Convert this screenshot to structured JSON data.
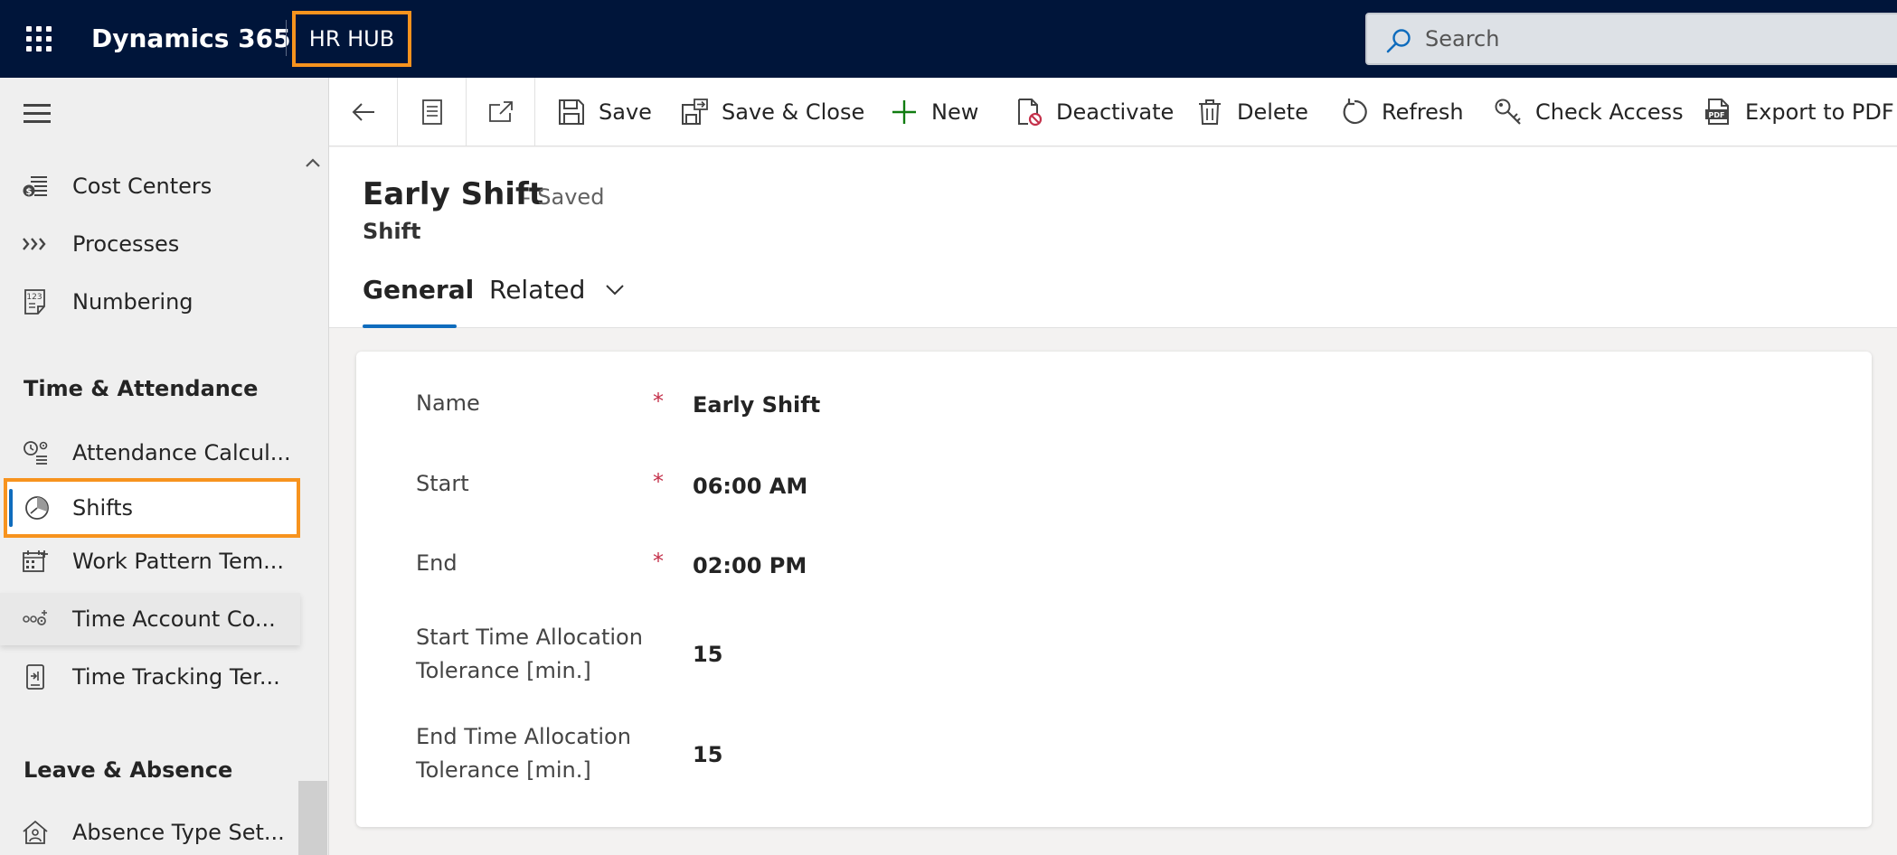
{
  "app": {
    "brand": "Dynamics 365",
    "title": "HR HUB"
  },
  "search": {
    "placeholder": "Search"
  },
  "sidebar": {
    "items": [
      {
        "label": "Cost Centers",
        "icon": "cost-center-icon"
      },
      {
        "label": "Processes",
        "icon": "processes-icon"
      },
      {
        "label": "Numbering",
        "icon": "numbering-icon"
      }
    ],
    "groups": [
      {
        "title": "Time & Attendance",
        "items": [
          {
            "label": "Attendance Calcul...",
            "icon": "attendance-calc-icon"
          },
          {
            "label": "Shifts",
            "icon": "shift-clock-icon",
            "selected": true
          },
          {
            "label": "Work Pattern Tem...",
            "icon": "calendar-icon"
          },
          {
            "label": "Time Account Co...",
            "icon": "time-account-icon"
          },
          {
            "label": "Time Tracking Ter...",
            "icon": "terminal-icon"
          }
        ]
      },
      {
        "title": "Leave & Absence",
        "items": [
          {
            "label": "Absence Type Set...",
            "icon": "absence-house-icon"
          }
        ]
      }
    ]
  },
  "commands": {
    "save": "Save",
    "save_close": "Save & Close",
    "new": "New",
    "deactivate": "Deactivate",
    "delete": "Delete",
    "refresh": "Refresh",
    "check_access": "Check Access",
    "export_pdf": "Export to PDF"
  },
  "record": {
    "title": "Early Shift",
    "status": "- Saved",
    "entity": "Shift"
  },
  "tabs": {
    "general": "General",
    "related": "Related"
  },
  "form": {
    "fields": [
      {
        "label": "Name",
        "required": "*",
        "value": "Early Shift"
      },
      {
        "label": "Start",
        "required": "*",
        "value": "06:00 AM"
      },
      {
        "label": "End",
        "required": "*",
        "value": "02:00 PM"
      },
      {
        "label_line1": "Start Time Allocation",
        "label_line2": "Tolerance [min.]",
        "value": "15"
      },
      {
        "label_line1": "End Time Allocation",
        "label_line2": "Tolerance [min.]",
        "value": "15"
      }
    ]
  },
  "colors": {
    "topbar": "#00153a",
    "highlight": "#f7931e",
    "accent": "#0f6cbd",
    "required": "#c4314b",
    "new_plus": "#107c10"
  }
}
